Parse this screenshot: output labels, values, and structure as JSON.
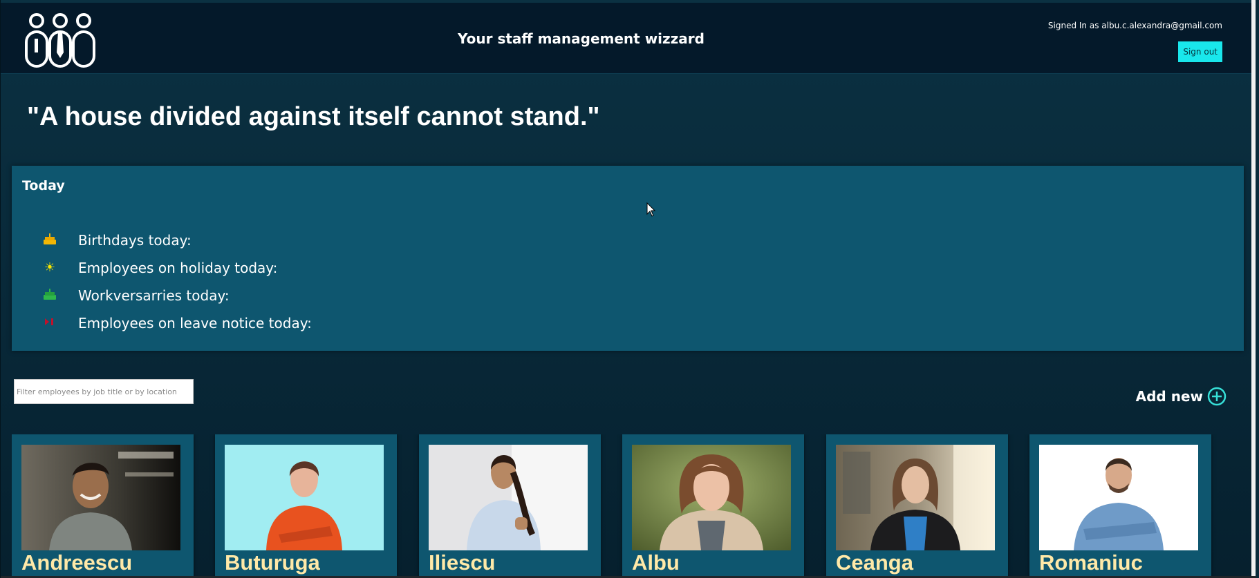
{
  "header": {
    "title": "Your staff management wizzard",
    "signed_in_text": "Signed In as albu.c.alexandra@gmail.com",
    "sign_out_label": "Sign out",
    "logo_icon": "team-logo-icon"
  },
  "quote": "\"A house divided against itself cannot stand.\"",
  "today": {
    "heading": "Today",
    "items": [
      {
        "icon": "cake-icon",
        "label": "Birthdays today:",
        "color": "#f2b705"
      },
      {
        "icon": "sun-icon",
        "label": "Employees on holiday today:",
        "color": "#f7e600"
      },
      {
        "icon": "cake-icon",
        "label": "Workversarries today:",
        "color": "#2fb84a"
      },
      {
        "icon": "leave-icon",
        "label": "Employees on leave notice today:",
        "color": "#c0112b"
      }
    ]
  },
  "filter": {
    "placeholder": "Filter employees by job title or by location",
    "value": ""
  },
  "add_new": {
    "label": "Add new",
    "icon": "plus-circle-icon",
    "color": "#37e0d8"
  },
  "employees": [
    {
      "name": "Andreescu"
    },
    {
      "name": "Buturuga"
    },
    {
      "name": "Iliescu"
    },
    {
      "name": "Albu"
    },
    {
      "name": "Ceanga"
    },
    {
      "name": "Romaniuc"
    }
  ],
  "colors": {
    "header_bg": "#04192a",
    "panel_bg": "#0e566f",
    "accent": "#19e7ec",
    "card_name": "#ffe9a8"
  }
}
